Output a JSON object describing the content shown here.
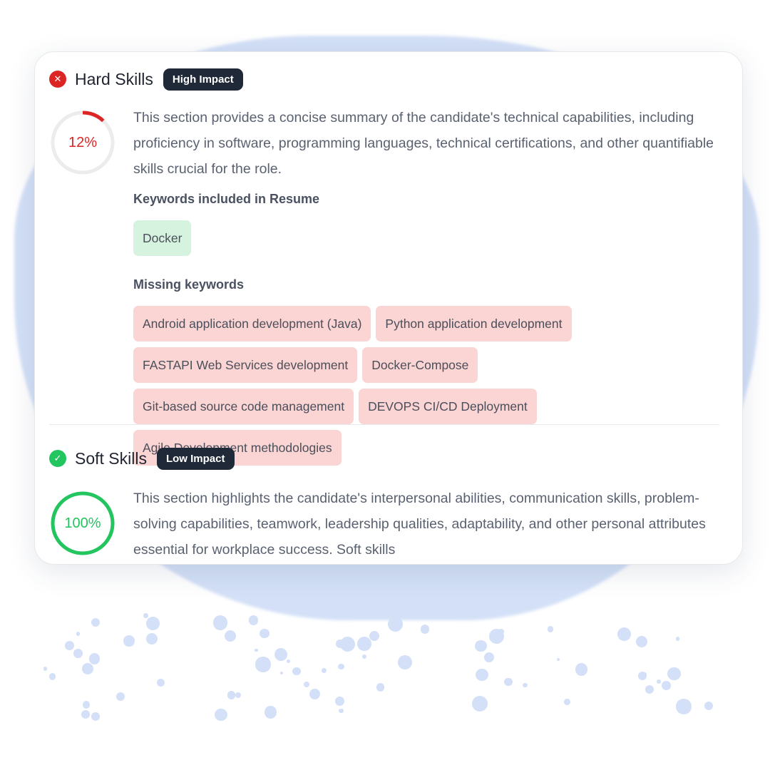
{
  "colors": {
    "fail": "#dc2626",
    "pass": "#22c55e",
    "badge": "#1f2937",
    "ring_track": "#ececec"
  },
  "hard": {
    "status_icon": "x-circle-icon",
    "title": "Hard Skills",
    "badge": "High Impact",
    "score": "12%",
    "score_value": 12,
    "description": "This section provides a concise summary of the candidate's technical capabilities, including proficiency in software, programming languages, technical certifications, and other quantifiable skills crucial for the role.",
    "included_label": "Keywords included in Resume",
    "included": [
      "Docker"
    ],
    "missing_label": "Missing keywords",
    "missing": [
      "Android application development (Java)",
      "Python application development",
      "FASTAPI Web Services development",
      "Docker-Compose",
      "Git-based source code management",
      "DEVOPS CI/CD Deployment",
      "Agile Development methodologies"
    ]
  },
  "soft": {
    "status_icon": "check-circle-icon",
    "title": "Soft Skills",
    "badge": "Low Impact",
    "score": "100%",
    "score_value": 100,
    "description": "This section highlights the candidate's interpersonal abilities, communication skills, problem-solving capabilities, teamwork, leadership qualities, adaptability, and other personal attributes essential for workplace success. Soft skills"
  }
}
